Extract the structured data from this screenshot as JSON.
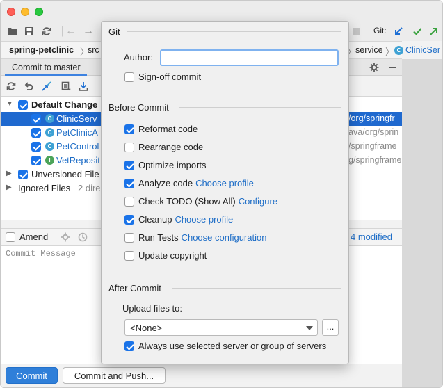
{
  "breadcrumb": {
    "project": "spring-petclinic",
    "src": "src",
    "service": "service",
    "class": "ClinicSer"
  },
  "toolbar": {
    "git_label": "Git:"
  },
  "panel": {
    "tab": "Commit to master",
    "modified": "4 modified"
  },
  "tree": {
    "default_changelist": "Default Change",
    "files": [
      {
        "name": "ClinicServ",
        "path": "/org/springfr",
        "icon": "class-icon"
      },
      {
        "name": "PetClinicA",
        "path": "ava/org/sprin",
        "icon": "class-icon"
      },
      {
        "name": "PetControl",
        "path": "/springframe",
        "icon": "class-icon"
      },
      {
        "name": "VetReposit",
        "path": "g/springframe",
        "icon": "interface-icon"
      }
    ],
    "unversioned": "Unversioned File",
    "ignored": "Ignored Files",
    "ignored_note": "2 dire"
  },
  "amend": {
    "label": "Amend"
  },
  "commit_message": {
    "placeholder": "Commit Message"
  },
  "buttons": {
    "commit": "Commit",
    "commit_push": "Commit and Push..."
  },
  "popup": {
    "git_section": "Git",
    "author_label": "Author:",
    "author_value": "",
    "signoff_label": "Sign-off commit",
    "before_section": "Before Commit",
    "before_options": [
      {
        "label": "Reformat code",
        "checked": true,
        "link": ""
      },
      {
        "label": "Rearrange code",
        "checked": false,
        "link": ""
      },
      {
        "label": "Optimize imports",
        "checked": true,
        "link": ""
      },
      {
        "label": "Analyze code",
        "checked": true,
        "link": "Choose profile"
      },
      {
        "label": "Check TODO (Show All)",
        "checked": false,
        "link": "Configure"
      },
      {
        "label": "Cleanup",
        "checked": true,
        "link": "Choose profile"
      },
      {
        "label": "Run Tests",
        "checked": false,
        "link": "Choose configuration"
      },
      {
        "label": "Update copyright",
        "checked": false,
        "link": ""
      }
    ],
    "after_section": "After Commit",
    "upload_label": "Upload files to:",
    "upload_value": "<None>",
    "browse_label": "...",
    "always_use_label": "Always use selected server or group of servers"
  },
  "colors": {
    "accent": "#1a73e8",
    "selection": "#1f69cf",
    "link": "#1f6ec7"
  }
}
